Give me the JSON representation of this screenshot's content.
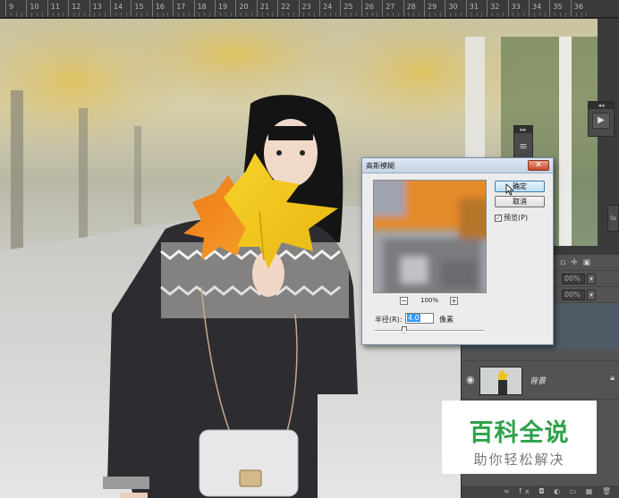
{
  "ruler": {
    "labels": [
      "9",
      "10",
      "11",
      "12",
      "13",
      "14",
      "15",
      "16",
      "17",
      "18",
      "19",
      "20",
      "21",
      "22",
      "23",
      "24",
      "25",
      "26",
      "27",
      "28",
      "29",
      "30",
      "31",
      "32",
      "33",
      "34",
      "35",
      "36"
    ]
  },
  "dialog": {
    "title": "高斯模糊",
    "close_label": "✕",
    "ok_label": "确定",
    "cancel_label": "取消",
    "preview_label": "预览(P)",
    "preview_checked": true,
    "zoom_out": "−",
    "zoom_value": "100%",
    "zoom_in": "+",
    "radius_label": "半径(R):",
    "radius_value": "4.0",
    "radius_unit": "像素",
    "radius_slider_fraction": 0.27
  },
  "layers": {
    "background_layer_name": "背景",
    "opacity_placeholder": "00%",
    "fill_placeholder": "00%",
    "footer_icons": "∞ fx ◘ ◐ ▭ ▦ 🗑"
  },
  "panels": {
    "small_panel_header": "▸▸",
    "play_panel_header": "◂◂",
    "play_icon": "▶",
    "edge_tab_label": "lu"
  },
  "watermark": {
    "title": "百科全说",
    "subtitle": "助你轻松解决"
  },
  "colors": {
    "accent_green": "#2fa14a",
    "leaf_yellow": "#f1c21b",
    "leaf_orange": "#f08a1c",
    "dialog_title_bg": "#c4d3e5"
  }
}
